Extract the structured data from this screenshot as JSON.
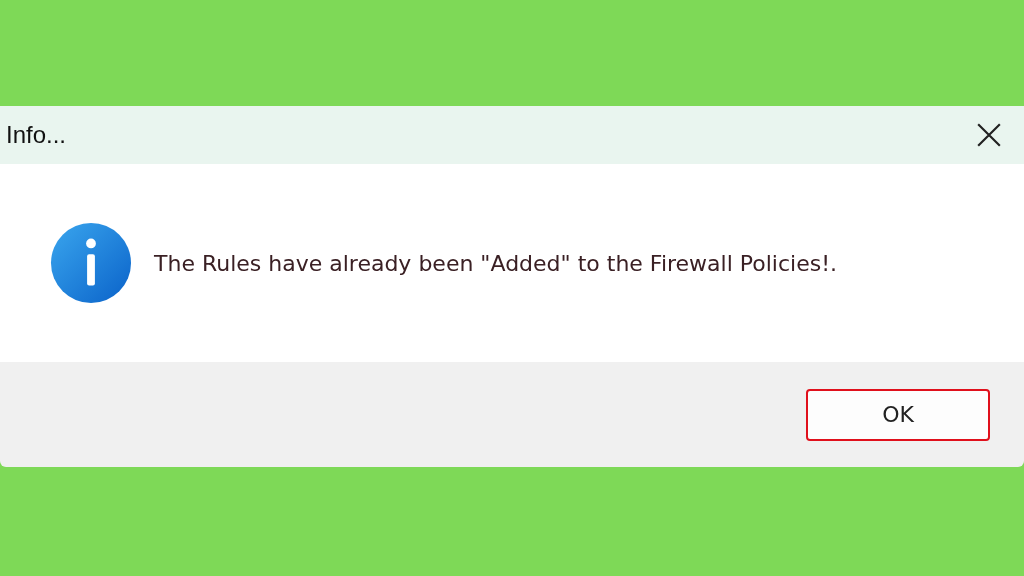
{
  "window": {
    "title": "Info..."
  },
  "message": "The Rules have already been \"Added\" to the Firewall Policies!.",
  "buttons": [
    {
      "label": "OK",
      "selected": true
    }
  ]
}
